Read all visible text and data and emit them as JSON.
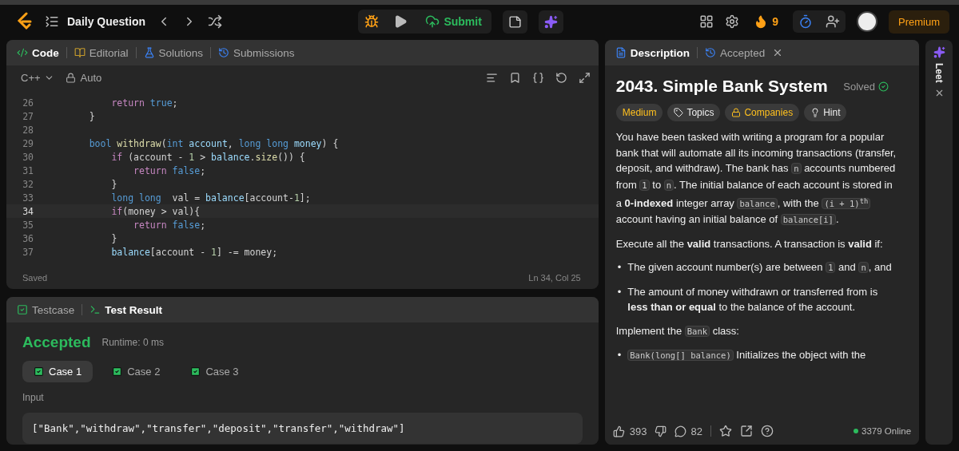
{
  "topbar": {
    "title": "Daily Question",
    "submit": "Submit",
    "streak": "9",
    "premium": "Premium"
  },
  "code_panel": {
    "tabs": [
      {
        "label": "Code",
        "selected": true
      },
      {
        "label": "Editorial",
        "selected": false
      },
      {
        "label": "Solutions",
        "selected": false
      },
      {
        "label": "Submissions",
        "selected": false
      }
    ],
    "language": "C++",
    "mode": "Auto",
    "lines": [
      {
        "number": "26",
        "current": false,
        "tokens": [
          {
            "kind": "keyword",
            "t": "        return"
          },
          {
            "kind": "literal",
            "t": " true"
          },
          {
            "kind": "plain",
            "t": ";"
          }
        ]
      },
      {
        "number": "27",
        "current": false,
        "tokens": [
          {
            "kind": "plain",
            "t": "    }"
          }
        ]
      },
      {
        "number": "28",
        "current": false
      },
      {
        "number": "29",
        "current": false,
        "tokens": [
          {
            "kind": "type",
            "t": "    bool"
          },
          {
            "kind": "function",
            "t": " withdraw"
          },
          {
            "kind": "plain",
            "t": "("
          },
          {
            "kind": "type",
            "t": "int"
          },
          {
            "kind": "variable",
            "t": " account"
          },
          {
            "kind": "plain",
            "t": ","
          },
          {
            "kind": "type",
            "t": " long long"
          },
          {
            "kind": "variable",
            "t": " money"
          },
          {
            "kind": "plain",
            "t": ") {"
          }
        ]
      },
      {
        "number": "30",
        "current": false,
        "tokens": [
          {
            "kind": "keyword",
            "t": "        if"
          },
          {
            "kind": "plain",
            "t": " (account -"
          },
          {
            "kind": "number",
            "t": " 1"
          },
          {
            "kind": "plain",
            "t": " >"
          },
          {
            "kind": "variable",
            "t": " balance"
          },
          {
            "kind": "plain",
            "t": "."
          },
          {
            "kind": "function",
            "t": "size"
          },
          {
            "kind": "plain",
            "t": "()) {"
          }
        ]
      },
      {
        "number": "31",
        "current": false,
        "tokens": [
          {
            "kind": "keyword",
            "t": "            return"
          },
          {
            "kind": "literal",
            "t": " false"
          },
          {
            "kind": "plain",
            "t": ";"
          }
        ]
      },
      {
        "number": "32",
        "current": false,
        "tokens": [
          {
            "kind": "plain",
            "t": "        }"
          }
        ]
      },
      {
        "number": "33",
        "current": false,
        "tokens": [
          {
            "kind": "type",
            "t": "        long long"
          },
          {
            "kind": "plain",
            "t": "  val ="
          },
          {
            "kind": "variable",
            "t": " balance"
          },
          {
            "kind": "plain",
            "t": "[account-"
          },
          {
            "kind": "number",
            "t": "1"
          },
          {
            "kind": "plain",
            "t": "];"
          }
        ]
      },
      {
        "number": "34",
        "current": true,
        "tokens": [
          {
            "kind": "keyword",
            "t": "        if"
          },
          {
            "kind": "plain",
            "t": "(money > val){"
          }
        ]
      },
      {
        "number": "35",
        "current": false,
        "tokens": [
          {
            "kind": "keyword",
            "t": "            return"
          },
          {
            "kind": "literal",
            "t": " false"
          },
          {
            "kind": "plain",
            "t": ";"
          }
        ]
      },
      {
        "number": "36",
        "current": false,
        "tokens": [
          {
            "kind": "plain",
            "t": "        }"
          }
        ]
      },
      {
        "number": "37",
        "current": false,
        "tokens": [
          {
            "kind": "variable",
            "t": "        balance"
          },
          {
            "kind": "plain",
            "t": "[account -"
          },
          {
            "kind": "number",
            "t": " 1"
          },
          {
            "kind": "plain",
            "t": "] -= money;"
          }
        ]
      }
    ],
    "saved": "Saved",
    "cursor": "Ln 34, Col 25"
  },
  "result_panel": {
    "tabs": [
      {
        "label": "Testcase",
        "selected": false
      },
      {
        "label": "Test Result",
        "selected": true
      }
    ],
    "status": "Accepted",
    "runtime": "Runtime: 0 ms",
    "cases": [
      {
        "label": "Case 1",
        "selected": true
      },
      {
        "label": "Case 2",
        "selected": false
      },
      {
        "label": "Case 3",
        "selected": false
      }
    ],
    "input_label": "Input",
    "input": "[\"Bank\",\"withdraw\",\"transfer\",\"deposit\",\"transfer\",\"withdraw\"]"
  },
  "description_panel": {
    "tabs": [
      {
        "label": "Description",
        "selected": true,
        "closable": false
      },
      {
        "label": "Accepted",
        "selected": false,
        "closable": true
      }
    ],
    "title": "2043. Simple Bank System",
    "solved": "Solved",
    "tags": [
      {
        "kind": "difficulty",
        "label": "Medium"
      },
      {
        "kind": "topics",
        "label": "Topics"
      },
      {
        "kind": "companies",
        "label": "Companies"
      },
      {
        "kind": "hint",
        "label": "Hint"
      }
    ],
    "blocks": [
      {
        "kind": "para",
        "parts": [
          {
            "kind": "text",
            "t": "You have been tasked with writing a program for a popular bank that will automate all its incoming transactions (transfer, deposit, and withdraw). The bank has "
          },
          {
            "kind": "code",
            "t": "n"
          },
          {
            "kind": "text",
            "t": " accounts numbered from "
          },
          {
            "kind": "code",
            "t": "1"
          },
          {
            "kind": "text",
            "t": " to "
          },
          {
            "kind": "code",
            "t": "n"
          },
          {
            "kind": "text",
            "t": ". The initial balance of each account is stored in a **0-indexed** integer array "
          },
          {
            "kind": "code",
            "t": "balance"
          },
          {
            "kind": "text",
            "t": ", with the "
          },
          {
            "kind": "code",
            "t": "(i + 1)$^{th}$"
          },
          {
            "kind": "text",
            "t": " account having an initial balance of "
          },
          {
            "kind": "code",
            "t": "balance[i]"
          },
          {
            "kind": "text",
            "t": "."
          }
        ]
      },
      {
        "kind": "para",
        "parts": [
          {
            "kind": "text",
            "t": "Execute all the **valid** transactions. A transaction is **valid** if:"
          }
        ]
      },
      {
        "kind": "bullet",
        "marker": "•",
        "parts": [
          {
            "kind": "text",
            "t": "The given account number(s) are between "
          },
          {
            "kind": "code",
            "t": "1"
          },
          {
            "kind": "text",
            "t": " and "
          },
          {
            "kind": "code",
            "t": "n"
          },
          {
            "kind": "text",
            "t": ", and"
          }
        ]
      },
      {
        "kind": "bullet",
        "marker": "•",
        "parts": [
          {
            "kind": "text",
            "t": "The amount of money withdrawn or transferred from is **less than or equal** to the balance of the account."
          }
        ]
      },
      {
        "kind": "para",
        "parts": [
          {
            "kind": "text",
            "t": "Implement the "
          },
          {
            "kind": "code",
            "t": "Bank"
          },
          {
            "kind": "text",
            "t": " class:"
          }
        ]
      },
      {
        "kind": "bullet",
        "marker": "•",
        "parts": [
          {
            "kind": "code",
            "t": "Bank(long[] balance)"
          },
          {
            "kind": "text",
            "t": " Initializes the object with the"
          }
        ]
      }
    ],
    "likes": "393",
    "comments": "82",
    "online": "3379 Online"
  },
  "side_panel": {
    "label": "Leet"
  }
}
